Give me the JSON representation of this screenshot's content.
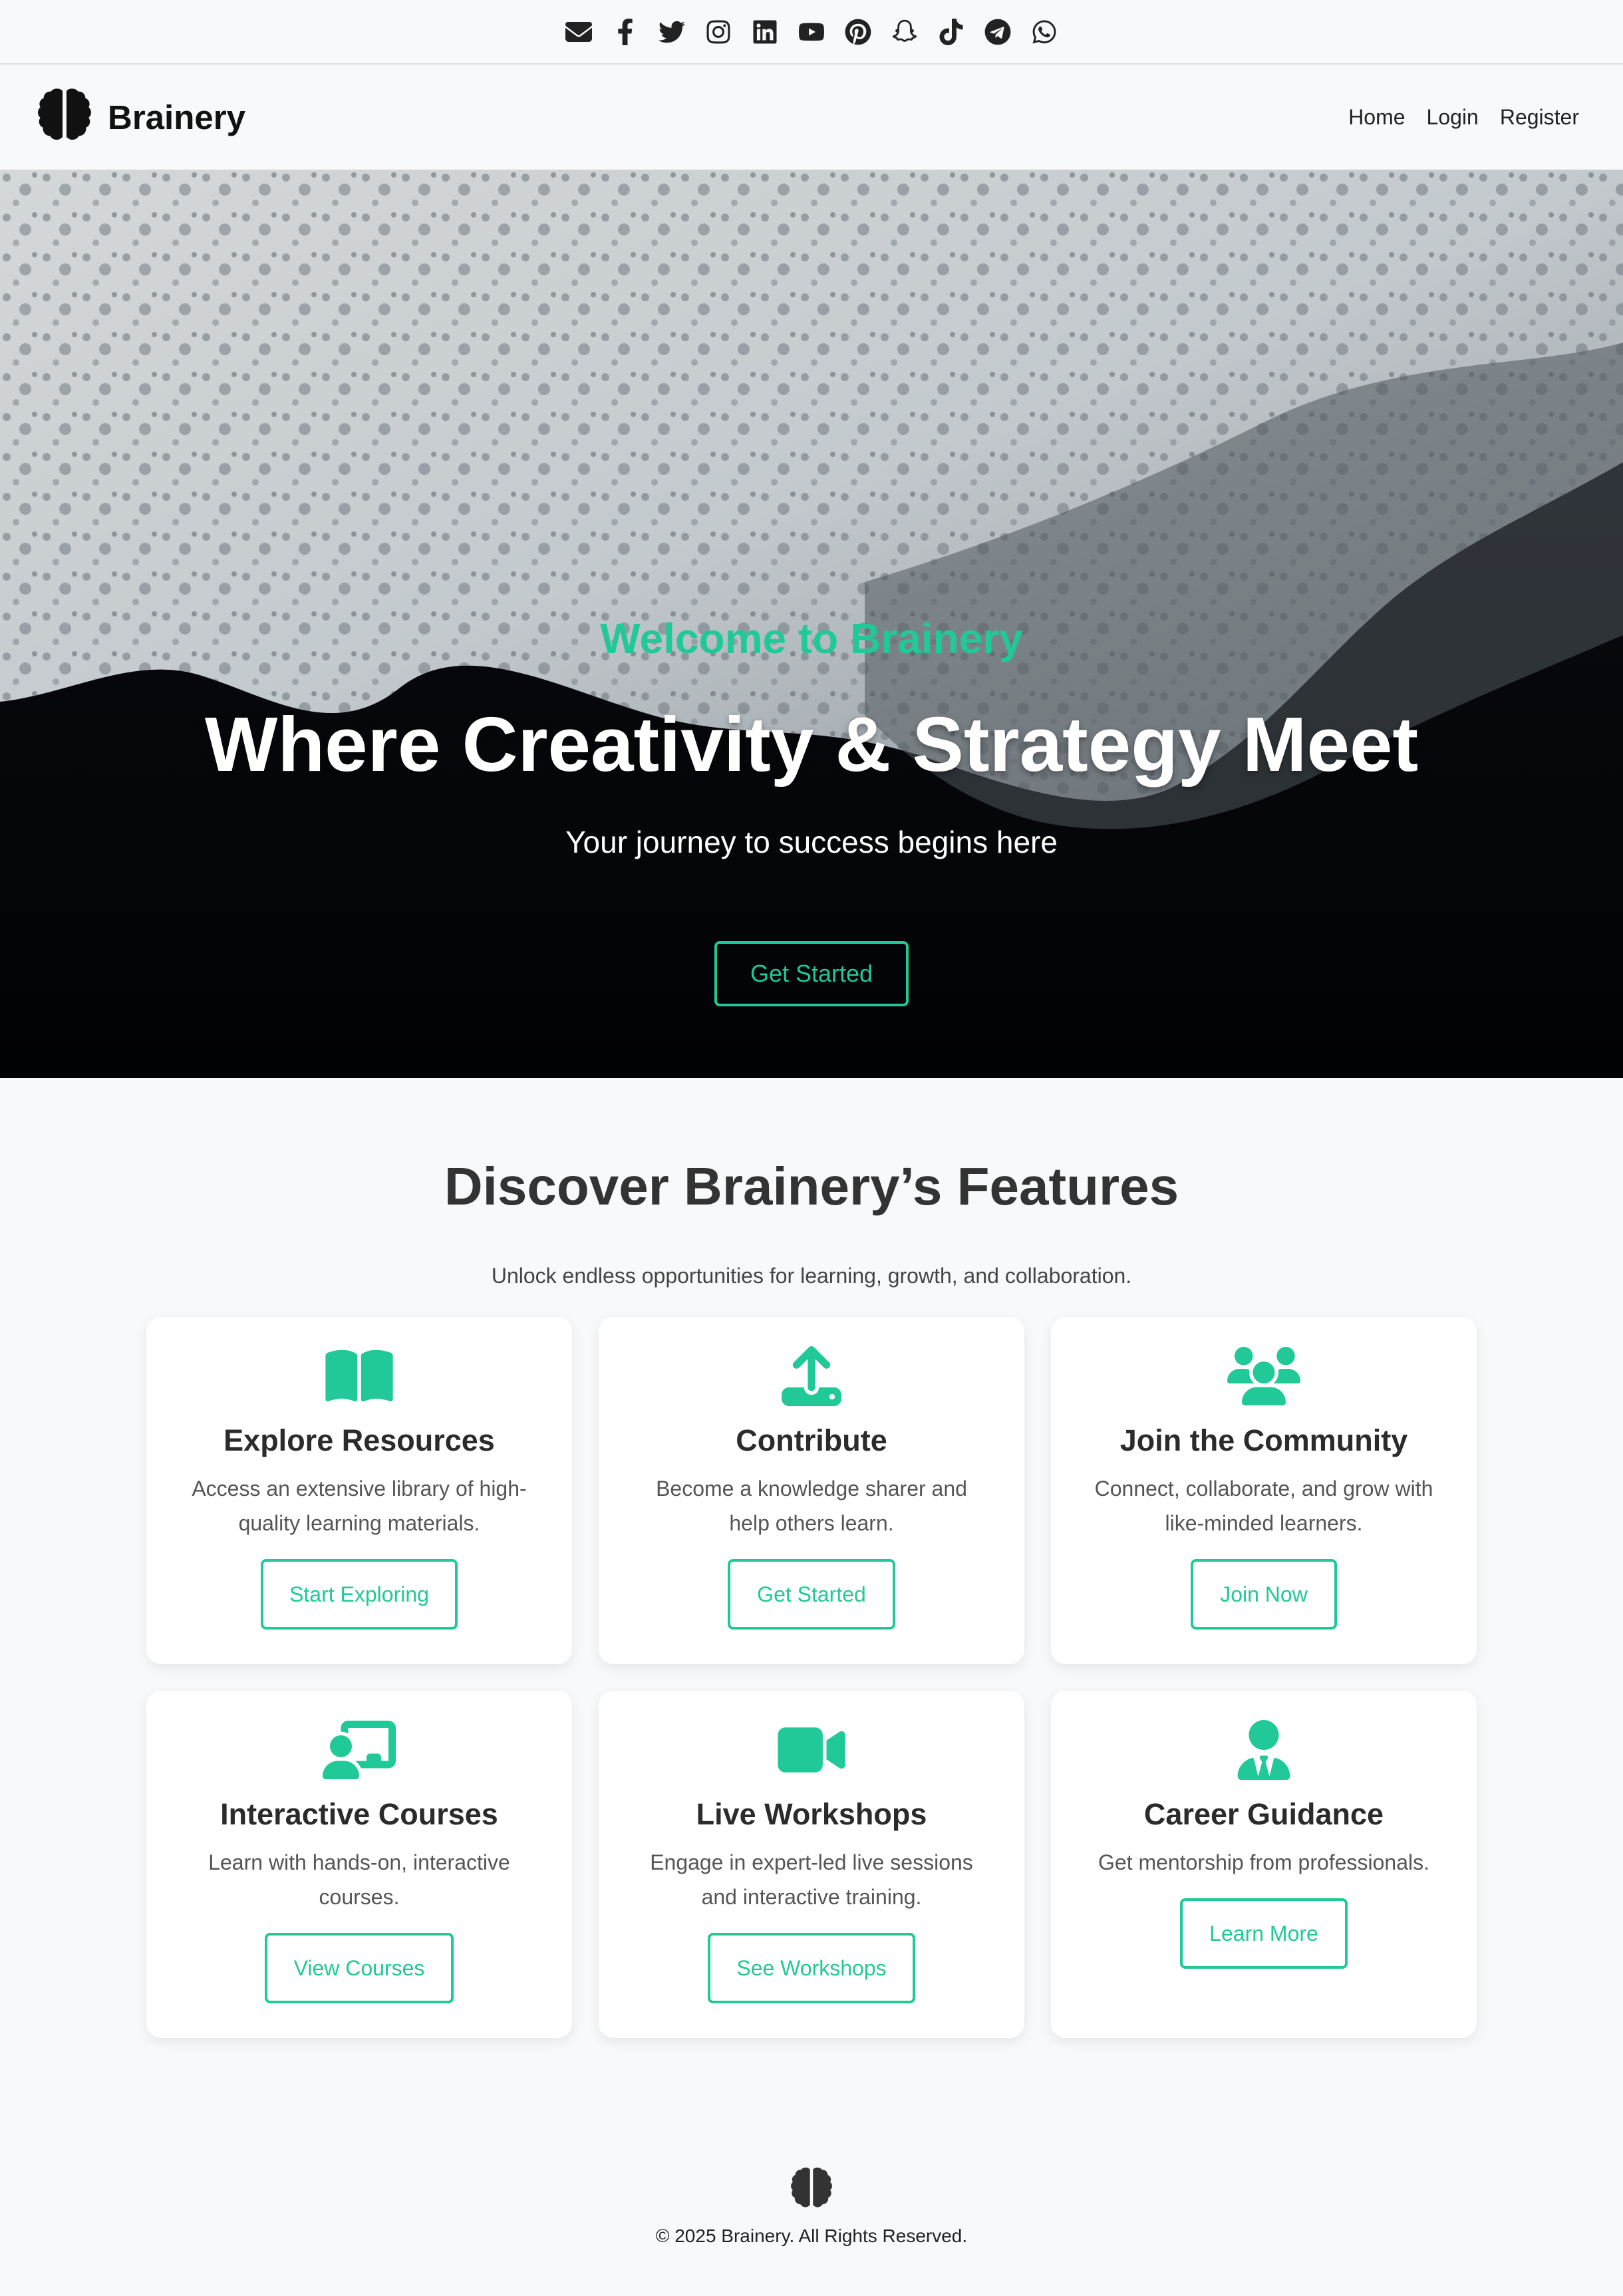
{
  "social": [
    {
      "name": "envelope-icon"
    },
    {
      "name": "facebook-icon"
    },
    {
      "name": "twitter-icon"
    },
    {
      "name": "instagram-icon"
    },
    {
      "name": "linkedin-icon"
    },
    {
      "name": "youtube-icon"
    },
    {
      "name": "pinterest-icon"
    },
    {
      "name": "snapchat-icon"
    },
    {
      "name": "tiktok-icon"
    },
    {
      "name": "telegram-icon"
    },
    {
      "name": "whatsapp-icon"
    }
  ],
  "navbar": {
    "brand": "Brainery",
    "logo_icon": "brain-icon",
    "links": [
      "Home",
      "Login",
      "Register"
    ]
  },
  "hero": {
    "kicker": "Welcome to Brainery",
    "title": "Where Creativity & Strategy Meet",
    "subtitle": "Your journey to success begins here",
    "cta": "Get Started"
  },
  "features": {
    "title": "Discover Brainery’s Features",
    "subtitle": "Unlock endless opportunities for learning, growth, and collaboration.",
    "cards": [
      {
        "icon": "book-icon",
        "title": "Explore Resources",
        "desc": "Access an extensive library of high-quality learning materials.",
        "button": "Start Exploring"
      },
      {
        "icon": "upload-icon",
        "title": "Contribute",
        "desc": "Become a knowledge sharer and help others learn.",
        "button": "Get Started"
      },
      {
        "icon": "users-icon",
        "title": "Join the Community",
        "desc": "Connect, collaborate, and grow with like-minded learners.",
        "button": "Join Now"
      },
      {
        "icon": "chalkboard-teacher-icon",
        "title": "Interactive Courses",
        "desc": "Learn with hands-on, interactive courses.",
        "button": "View Courses"
      },
      {
        "icon": "video-icon",
        "title": "Live Workshops",
        "desc": "Engage in expert-led live sessions and interactive training.",
        "button": "See Workshops"
      },
      {
        "icon": "user-tie-icon",
        "title": "Career Guidance",
        "desc": "Get mentorship from professionals.",
        "button": "Learn More"
      }
    ]
  },
  "footer": {
    "text": "© 2025 Brainery. All Rights Reserved."
  },
  "colors": {
    "accent": "#20c997",
    "background": "#f8f9fa",
    "text": "#333333"
  }
}
